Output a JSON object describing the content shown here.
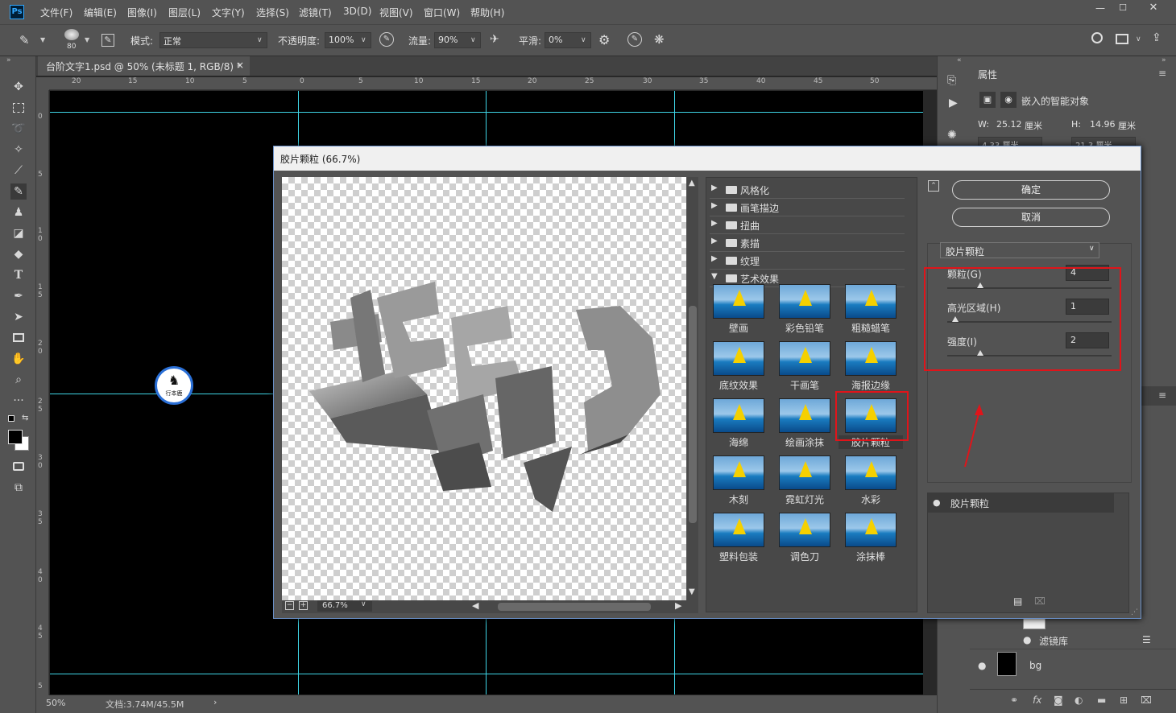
{
  "app": {
    "logo": "Ps"
  },
  "menu": [
    "文件(F)",
    "编辑(E)",
    "图像(I)",
    "图层(L)",
    "文字(Y)",
    "选择(S)",
    "滤镜(T)",
    "3D(D)",
    "视图(V)",
    "窗口(W)",
    "帮助(H)"
  ],
  "options": {
    "brush_size": "80",
    "mode_label": "模式:",
    "mode_value": "正常",
    "opacity_label": "不透明度:",
    "opacity_value": "100%",
    "flow_label": "流量:",
    "flow_value": "90%",
    "smooth_label": "平滑:",
    "smooth_value": "0%"
  },
  "document": {
    "tab_title": "台阶文字1.psd @ 50% (未标题 1, RGB/8) *",
    "close": "×",
    "zoom": "50%",
    "doc_info": "文档:3.74M/45.5M",
    "status_arrow": "›"
  },
  "ruler_h": [
    "20",
    "15",
    "10",
    "5",
    "0",
    "5",
    "10",
    "15",
    "20",
    "25",
    "30",
    "35",
    "40",
    "45",
    "50"
  ],
  "ruler_v": [
    "0",
    "5",
    "1 0",
    "1 5",
    "2 0",
    "2 5",
    "3 0",
    "3 5",
    "4 0",
    "4 5",
    "5"
  ],
  "stamp_text": "行本鹿",
  "properties": {
    "title": "属性",
    "smart_object": "嵌入的智能对象",
    "w_label": "W:",
    "w_value": "25.12",
    "w_unit": "厘米",
    "h_label": "H:",
    "h_value": "14.96",
    "h_unit": "厘米",
    "x_value": "4.33 厘米",
    "y_value": "21.3 厘米"
  },
  "layers": {
    "filter_lib": "滤镜库",
    "bg_name": "bg"
  },
  "dialog": {
    "title": "胶片颗粒 (66.7%)",
    "ok": "确定",
    "cancel": "取消",
    "filter_select": "胶片颗粒",
    "zoom": "66.7%",
    "categories": [
      {
        "label": "风格化",
        "open": false
      },
      {
        "label": "画笔描边",
        "open": false
      },
      {
        "label": "扭曲",
        "open": false
      },
      {
        "label": "素描",
        "open": false
      },
      {
        "label": "纹理",
        "open": false
      },
      {
        "label": "艺术效果",
        "open": true
      }
    ],
    "thumbnails": [
      "壁画",
      "彩色铅笔",
      "粗糙蜡笔",
      "底纹效果",
      "干画笔",
      "海报边缘",
      "海绵",
      "绘画涂抹",
      "胶片颗粒",
      "木刻",
      "霓虹灯光",
      "水彩",
      "塑料包装",
      "调色刀",
      "涂抹棒"
    ],
    "selected": "胶片颗粒",
    "params": [
      {
        "label": "颗粒(G)",
        "value": "4",
        "level": 0.2
      },
      {
        "label": "高光区域(H)",
        "value": "1",
        "level": 0.05
      },
      {
        "label": "强度(I)",
        "value": "2",
        "level": 0.2
      }
    ],
    "applied_layer": "胶片颗粒"
  },
  "colors": {
    "accent": "#3fd5e6",
    "highlight": "#e0141a",
    "panel": "#535353",
    "canvas": "#000000"
  }
}
